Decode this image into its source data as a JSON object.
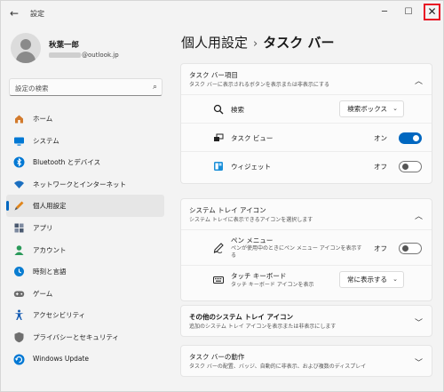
{
  "titlebar": {
    "back": "←",
    "title": "設定",
    "minimize": "─",
    "maximize": "☐",
    "close": "✕"
  },
  "profile": {
    "name": "秋葉一郎",
    "email_domain": "@outlook.jp"
  },
  "search": {
    "placeholder": "設定の検索",
    "icon": "⌕"
  },
  "sidebar": {
    "items": [
      {
        "label": "ホーム",
        "icon": "home-icon",
        "color": "#d27a2c"
      },
      {
        "label": "システム",
        "icon": "system-icon",
        "color": "#0078d4"
      },
      {
        "label": "Bluetooth とデバイス",
        "icon": "bluetooth-icon",
        "color": "#0078d4"
      },
      {
        "label": "ネットワークとインターネット",
        "icon": "network-icon",
        "color": "#1b6fc0"
      },
      {
        "label": "個人用設定",
        "icon": "personalization-icon",
        "color": "#e0851c",
        "selected": true
      },
      {
        "label": "アプリ",
        "icon": "apps-icon",
        "color": "#4b5a70"
      },
      {
        "label": "アカウント",
        "icon": "accounts-icon",
        "color": "#2b9a5a"
      },
      {
        "label": "時刻と言語",
        "icon": "time-language-icon",
        "color": "#0a7dd1"
      },
      {
        "label": "ゲーム",
        "icon": "gaming-icon",
        "color": "#6b6b6b"
      },
      {
        "label": "アクセシビリティ",
        "icon": "accessibility-icon",
        "color": "#1a5fb4"
      },
      {
        "label": "プライバシーとセキュリティ",
        "icon": "privacy-icon",
        "color": "#6f6f6f"
      },
      {
        "label": "Windows Update",
        "icon": "windows-update-icon",
        "color": "#0078d4"
      }
    ]
  },
  "breadcrumb": {
    "parent": "個人用設定",
    "separator": "›",
    "current": "タスク バー"
  },
  "taskbar_items": {
    "title": "タスク バー項目",
    "subtitle": "タスク バーに表示されるボタンを表示または非表示にする",
    "chevron": "︿",
    "search": {
      "label": "検索",
      "value": "検索ボックス",
      "chev": "⌄"
    },
    "taskview": {
      "label": "タスク ビュー",
      "state": "オン"
    },
    "widgets": {
      "label": "ウィジェット",
      "state": "オフ"
    }
  },
  "system_tray": {
    "title": "システム トレイ アイコン",
    "subtitle": "システム トレイに表示できるアイコンを選択します",
    "chevron": "︿",
    "pen": {
      "label": "ペン メニュー",
      "sub": "ペンが使用中のときにペン メニュー アイコンを表示する",
      "state": "オフ"
    },
    "touch_keyboard": {
      "label": "タッチ キーボード",
      "sub": "タッチ キーボード アイコンを表示",
      "value": "常に表示する",
      "chev": "⌄"
    }
  },
  "other_tray": {
    "title": "その他のシステム トレイ アイコン",
    "subtitle": "追加のシステム トレイ アイコンを表示または非表示にします",
    "chevron": "﹀"
  },
  "behaviors": {
    "title": "タスク バーの動作",
    "subtitle": "タスク バーの配置、バッジ、自動的に非表示、および複数のディスプレイ",
    "chevron": "﹀"
  },
  "colors": {
    "accent": "#0067c0",
    "close_highlight": "#e81123"
  }
}
